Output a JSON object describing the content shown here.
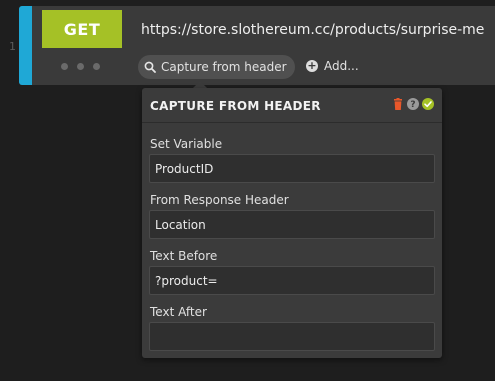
{
  "gutter": {
    "line_number": "1"
  },
  "request": {
    "method": "GET",
    "url": "https://store.slothereum.cc/products/surprise-me",
    "capture_chip_label": "Capture from header",
    "add_label": "Add..."
  },
  "popover": {
    "title": "CAPTURE FROM HEADER",
    "fields": [
      {
        "label": "Set Variable",
        "value": "ProductID"
      },
      {
        "label": "From Response Header",
        "value": "Location"
      },
      {
        "label": "Text Before",
        "value": "?product="
      },
      {
        "label": "Text After",
        "value": ""
      }
    ]
  },
  "colors": {
    "accent": "#1fa8d6",
    "method_bg": "#a5c126",
    "delete": "#e8572a",
    "confirm": "#a5c126"
  },
  "icons": [
    "search-icon",
    "plus-circle-icon",
    "trash-icon",
    "help-icon",
    "check-icon"
  ]
}
